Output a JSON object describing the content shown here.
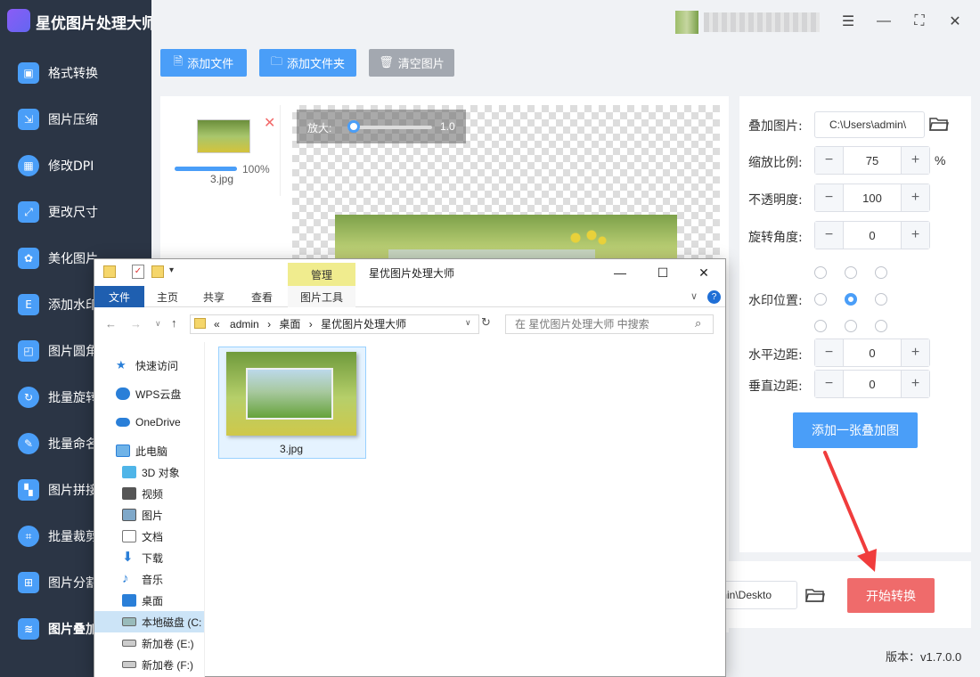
{
  "app": {
    "title": "星优图片处理大师",
    "version": "版本：v1.7.0.0"
  },
  "sidebar": {
    "items": [
      {
        "label": "格式转换",
        "icon": "image-convert-icon",
        "color": "#4a9ef8"
      },
      {
        "label": "图片压缩",
        "icon": "image-compress-icon",
        "color": "#4a9ef8"
      },
      {
        "label": "修改DPI",
        "icon": "dpi-icon",
        "color": "#4a9ef8"
      },
      {
        "label": "更改尺寸",
        "icon": "resize-icon",
        "color": "#4a9ef8"
      },
      {
        "label": "美化图片",
        "icon": "beautify-icon",
        "color": "#4a9ef8"
      },
      {
        "label": "添加水印",
        "icon": "watermark-icon",
        "color": "#4a9ef8"
      },
      {
        "label": "图片圆角",
        "icon": "round-corner-icon",
        "color": "#4a9ef8"
      },
      {
        "label": "批量旋转",
        "icon": "rotate-icon",
        "color": "#4a9ef8"
      },
      {
        "label": "批量命名",
        "icon": "rename-icon",
        "color": "#4a9ef8"
      },
      {
        "label": "图片拼接",
        "icon": "puzzle-icon",
        "color": "#4a9ef8"
      },
      {
        "label": "批量裁剪",
        "icon": "crop-icon",
        "color": "#4a9ef8"
      },
      {
        "label": "图片分割",
        "icon": "split-icon",
        "color": "#4a9ef8"
      },
      {
        "label": "图片叠加",
        "icon": "layers-icon",
        "color": "#4a9ef8",
        "active": true
      }
    ]
  },
  "toolbar": {
    "add_file": "添加文件",
    "add_folder": "添加文件夹",
    "clear_images": "清空图片"
  },
  "file_list": [
    {
      "name": "3.jpg",
      "progress_pct": "100%",
      "progress": 1.0
    }
  ],
  "preview": {
    "zoom_label": "放大:",
    "zoom_value": "1.0"
  },
  "settings": {
    "overlay_image_label": "叠加图片:",
    "overlay_image_path": "C:\\Users\\admin\\",
    "scale_label": "缩放比例:",
    "scale_value": "75",
    "scale_unit": "%",
    "opacity_label": "不透明度:",
    "opacity_value": "100",
    "rotation_label": "旋转角度:",
    "rotation_value": "0",
    "position_label": "水印位置:",
    "position_selected": "middle-center",
    "h_margin_label": "水平边距:",
    "h_margin_value": "0",
    "v_margin_label": "垂直边距:",
    "v_margin_value": "0",
    "add_overlay_button": "添加一张叠加图"
  },
  "output": {
    "path": "min\\Deskto",
    "start_button": "开始转换"
  },
  "colors": {
    "accent": "#4a9ef8",
    "sidebar_bg": "#2b3545",
    "start_button": "#ef6b6b",
    "arrow": "#f03c3c"
  },
  "explorer": {
    "title": "星优图片处理大师",
    "ribbon_context_tab": "管理",
    "tabs": [
      "文件",
      "主页",
      "共享",
      "查看",
      "图片工具"
    ],
    "address": {
      "prefix": "«",
      "parts": [
        "admin",
        "桌面",
        "星优图片处理大师"
      ]
    },
    "search_placeholder": "在 星优图片处理大师 中搜索",
    "nav": [
      {
        "label": "快速访问",
        "icon": "star-icon"
      },
      {
        "label": "WPS云盘",
        "icon": "cloud-icon"
      },
      {
        "label": "OneDrive",
        "icon": "onedrive-icon"
      },
      {
        "label": "此电脑",
        "icon": "computer-icon"
      },
      {
        "label": "3D 对象",
        "icon": "cube-icon"
      },
      {
        "label": "视频",
        "icon": "video-icon"
      },
      {
        "label": "图片",
        "icon": "pictures-icon"
      },
      {
        "label": "文档",
        "icon": "document-icon"
      },
      {
        "label": "下载",
        "icon": "download-icon"
      },
      {
        "label": "音乐",
        "icon": "music-icon"
      },
      {
        "label": "桌面",
        "icon": "desktop-icon"
      },
      {
        "label": "本地磁盘 (C:",
        "icon": "drive-icon",
        "selected": true
      },
      {
        "label": "新加卷 (E:)",
        "icon": "drive-icon"
      },
      {
        "label": "新加卷 (F:)",
        "icon": "drive-icon"
      }
    ],
    "files": [
      {
        "name": "3.jpg"
      }
    ]
  }
}
